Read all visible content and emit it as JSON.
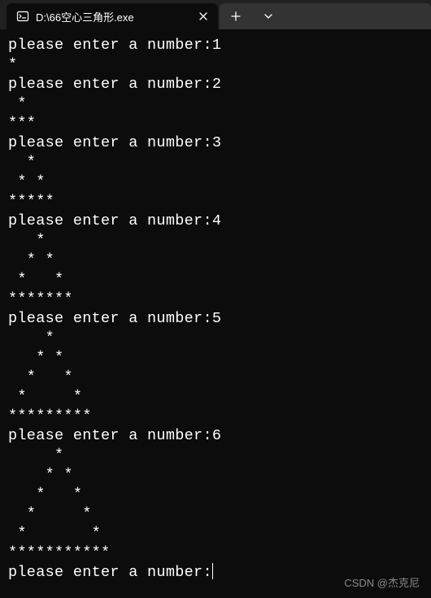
{
  "titlebar": {
    "tab": {
      "icon": "terminal-icon",
      "title": "D:\\66空心三角形.exe",
      "close_label": "×"
    },
    "actions": {
      "new_tab": "+",
      "dropdown": "⌄"
    }
  },
  "console": {
    "lines": [
      "please enter a number:1",
      "*",
      "please enter a number:2",
      " *",
      "***",
      "please enter a number:3",
      "  *",
      " * *",
      "*****",
      "please enter a number:4",
      "   *",
      "  * *",
      " *   *",
      "*******",
      "please enter a number:5",
      "    *",
      "   * *",
      "  *   *",
      " *     *",
      "*********",
      "please enter a number:6",
      "     *",
      "    * *",
      "   *   *",
      "  *     *",
      " *       *",
      "***********",
      "please enter a number:"
    ]
  },
  "watermark": "CSDN @杰克尼"
}
